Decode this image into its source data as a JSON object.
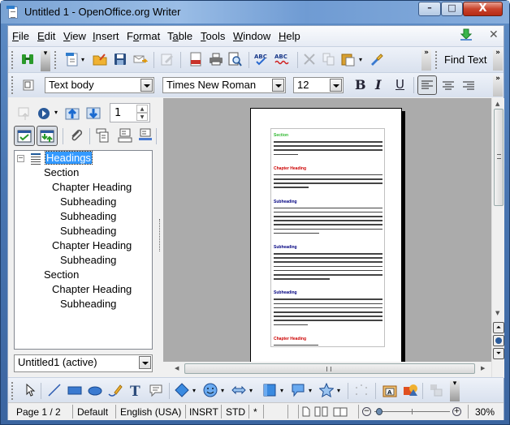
{
  "window": {
    "title": "Untitled 1 - OpenOffice.org Writer",
    "controls": {
      "minimize": "–",
      "maximize": "□",
      "close": "X"
    }
  },
  "menubar": {
    "items": [
      {
        "label": "File",
        "accel": "F",
        "rest": "ile"
      },
      {
        "label": "Edit",
        "accel": "E",
        "rest": "dit"
      },
      {
        "label": "View",
        "accel": "V",
        "rest": "iew"
      },
      {
        "label": "Insert",
        "accel": "I",
        "rest": "nsert"
      },
      {
        "label": "Format",
        "pre": "F",
        "accel": "o",
        "rest": "rmat"
      },
      {
        "label": "Table",
        "pre": "T",
        "accel": "a",
        "rest": "ble"
      },
      {
        "label": "Tools",
        "accel": "T",
        "rest": "ools"
      },
      {
        "label": "Window",
        "accel": "W",
        "rest": "indow"
      },
      {
        "label": "Help",
        "accel": "H",
        "rest": "elp"
      }
    ],
    "close_doc": "✕"
  },
  "standard_toolbar": {
    "icons": [
      "navigator-icon",
      "new-document-icon",
      "open-icon",
      "save-icon",
      "email-icon",
      "edit-file-icon",
      "export-pdf-icon",
      "print-icon",
      "page-preview-icon",
      "spellcheck-icon",
      "autospellcheck-icon",
      "cut-icon",
      "copy-icon",
      "paste-icon",
      "clone-formatting-icon"
    ],
    "find_text_label": "Find Text",
    "overflow": "»"
  },
  "formatting_toolbar": {
    "paragraph_style": "Text body",
    "font_name": "Times New Roman",
    "font_size": "12",
    "bold": "B",
    "italic": "I",
    "underline": "U",
    "align_left_active": true
  },
  "navigator": {
    "page_number": "1",
    "tree": [
      {
        "label": "Headings",
        "level": 0,
        "selected": true
      },
      {
        "label": "Section",
        "level": 1
      },
      {
        "label": "Chapter Heading",
        "level": 2
      },
      {
        "label": "Subheading",
        "level": 3
      },
      {
        "label": "Subheading",
        "level": 3
      },
      {
        "label": "Subheading",
        "level": 3
      },
      {
        "label": "Chapter Heading",
        "level": 2
      },
      {
        "label": "Subheading",
        "level": 3
      },
      {
        "label": "Section",
        "level": 1
      },
      {
        "label": "Chapter Heading",
        "level": 2
      },
      {
        "label": "Subheading",
        "level": 3
      }
    ],
    "document_select": "Untitled1 (active)"
  },
  "document_preview": {
    "blocks": [
      {
        "heading": "Section",
        "color": "#2eb82e",
        "lines": 4
      },
      {
        "heading": "Chapter Heading",
        "color": "#cc0000",
        "lines": 4
      },
      {
        "heading": "Subheading",
        "color": "#000080",
        "lines": 7
      },
      {
        "heading": "Subheading",
        "color": "#000080",
        "lines": 7
      },
      {
        "heading": "Subheading",
        "color": "#000080",
        "lines": 7
      },
      {
        "heading": "Chapter Heading",
        "color": "#cc0000",
        "lines": 1
      }
    ]
  },
  "statusbar": {
    "page": "Page 1 / 2",
    "page_style": "Default",
    "language": "English (USA)",
    "insert_mode": "INSRT",
    "selection_mode": "STD",
    "modified": "*",
    "zoom": "30%",
    "zoom_slider_percent": 30
  }
}
